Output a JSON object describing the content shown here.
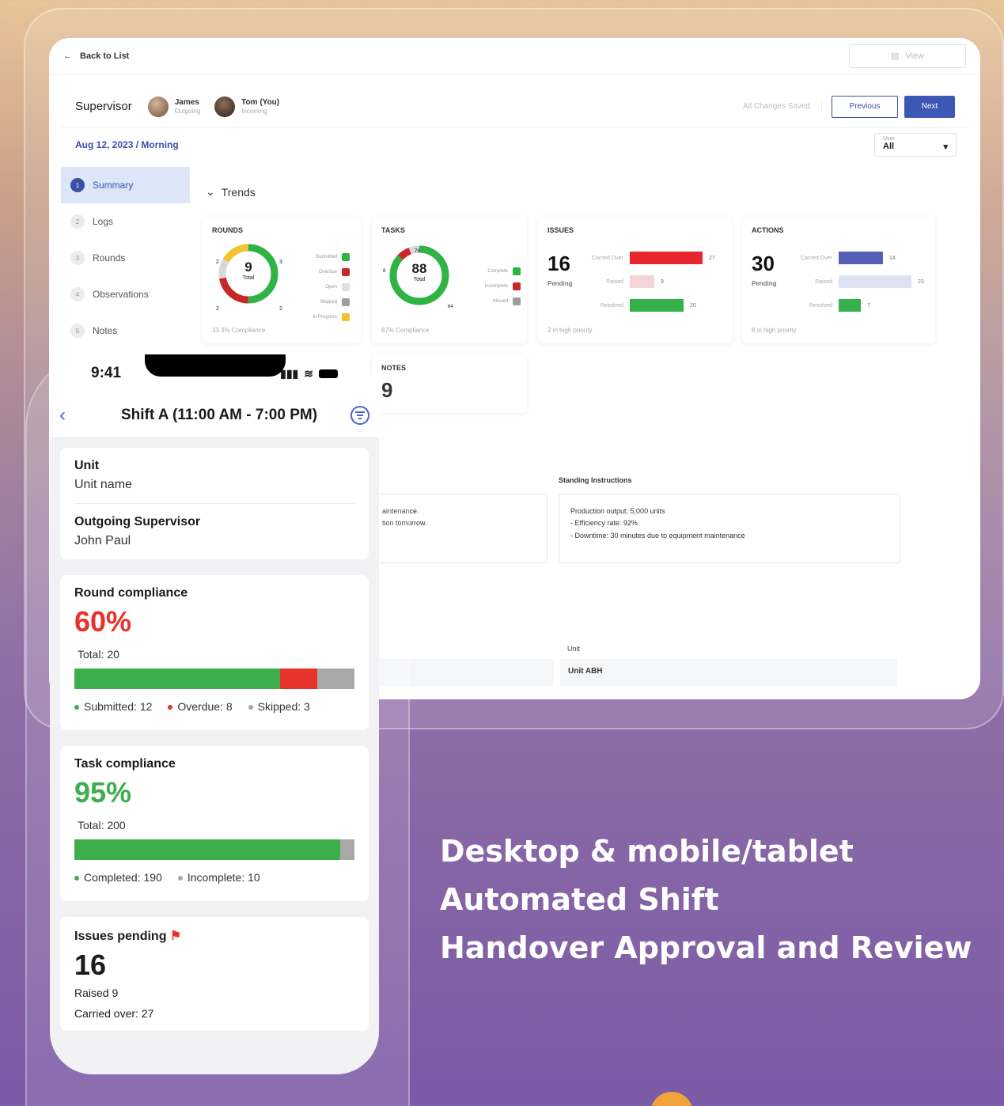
{
  "desktop": {
    "back_label": "Back to List",
    "view_label": "View",
    "supervisor_label": "Supervisor",
    "people": [
      {
        "name": "James",
        "role": "Outgoing"
      },
      {
        "name": "Tom (You)",
        "role": "Incoming"
      }
    ],
    "saved_status": "All Changes Saved",
    "prev_label": "Previous",
    "next_label": "Next",
    "date_shift": "Aug 12, 2023 / Morning",
    "user_filter": {
      "label": "User",
      "value": "All"
    },
    "nav": [
      {
        "num": "1",
        "label": "Summary"
      },
      {
        "num": "2",
        "label": "Logs"
      },
      {
        "num": "3",
        "label": "Rounds"
      },
      {
        "num": "4",
        "label": "Observations"
      },
      {
        "num": "5",
        "label": "Notes"
      }
    ],
    "trends_label": "Trends",
    "rounds": {
      "title": "ROUNDS",
      "center_value": "9",
      "center_label": "Total",
      "legend": [
        {
          "label": "Submitted",
          "color": "#2fb344"
        },
        {
          "label": "Overdue",
          "color": "#c62828"
        },
        {
          "label": "Open",
          "color": "#e0e0e0"
        },
        {
          "label": "Skipped",
          "color": "#9e9e9e"
        },
        {
          "label": "In Progress",
          "color": "#f2c230"
        }
      ],
      "donut_labels": [
        "2",
        "3",
        "2",
        "2"
      ],
      "footer": "33.3% Compliance"
    },
    "tasks": {
      "title": "TASKS",
      "center_value": "88",
      "center_label": "Total",
      "legend": [
        {
          "label": "Complete",
          "color": "#2fb344"
        },
        {
          "label": "Incomplete",
          "color": "#c62828"
        },
        {
          "label": "Missed",
          "color": "#9e9e9e"
        }
      ],
      "donut_labels": [
        "76",
        "8",
        "64"
      ],
      "footer": "87% Compliance"
    },
    "issues": {
      "title": "ISSUES",
      "value": "16",
      "sub": "Pending",
      "bars": [
        {
          "label": "Carried Over",
          "value": 27,
          "color": "#e8262e"
        },
        {
          "label": "Raised",
          "value": 9,
          "color": "#f6d3d9"
        },
        {
          "label": "Resolved",
          "value": 20,
          "color": "#34b14a"
        }
      ],
      "footer": "2 in high priority"
    },
    "actions": {
      "title": "ACTIONS",
      "value": "30",
      "sub": "Pending",
      "bars": [
        {
          "label": "Carried Over",
          "value": 14,
          "color": "#5560b8"
        },
        {
          "label": "Raised",
          "value": 23,
          "color": "#dfe2f3"
        },
        {
          "label": "Resolved",
          "value": 7,
          "color": "#34b14a"
        }
      ],
      "footer": "8 in high priority"
    },
    "notes": {
      "title": "NOTES",
      "value": "9"
    },
    "partial_text": [
      "aintenance.",
      "tion tomorrow."
    ],
    "standing_label": "Standing Instructions",
    "standing_lines": [
      "Production output: 5,000 units",
      "- Efficiency rate: 92%",
      "- Downtime: 30 minutes due to equipment maintenance"
    ],
    "unit_label": "Unit",
    "unit_value": "Unit ABH"
  },
  "phone": {
    "time": "9:41",
    "title": "Shift A (11:00 AM - 7:00 PM)",
    "unit_label": "Unit",
    "unit_value": "Unit name",
    "outgoing_label": "Outgoing Supervisor",
    "outgoing_value": "John Paul",
    "round": {
      "label": "Round compliance",
      "percent": "60%",
      "total": "Total: 20",
      "segments": [
        {
          "label": "Submitted: 12",
          "value": 12,
          "color": "#3dae4c"
        },
        {
          "label": "Overdue: 8",
          "value": 3,
          "color": "#e8322c"
        },
        {
          "label": "Skipped: 3",
          "value": 3,
          "color": "#a8a8a8"
        }
      ]
    },
    "task": {
      "label": "Task compliance",
      "percent": "95%",
      "total": "Total: 200",
      "segments": [
        {
          "label": "Completed: 190",
          "value": 190,
          "color": "#3dae4c"
        },
        {
          "label": "Incomplete: 10",
          "value": 10,
          "color": "#a8a8a8"
        }
      ]
    },
    "issues": {
      "label": "Issues pending",
      "value": "16",
      "raised": "Raised 9",
      "carried": "Carried over: 27"
    }
  },
  "tagline": [
    "Desktop & mobile/tablet",
    "Automated Shift",
    "Handover Approval and Review"
  ],
  "colors": {
    "primary": "#3d57b5",
    "green": "#3dae4c",
    "red": "#e8322c"
  }
}
